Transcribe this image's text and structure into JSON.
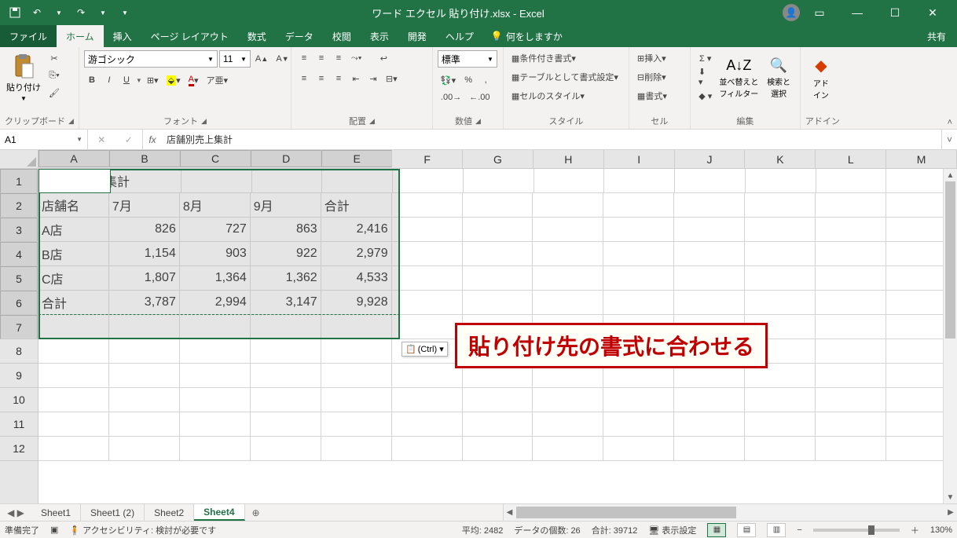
{
  "app": {
    "title": "ワード エクセル 貼り付け.xlsx - Excel"
  },
  "qat": {
    "save": "save-icon",
    "undo": "undo-icon",
    "redo": "redo-icon"
  },
  "tabs": {
    "file": "ファイル",
    "home": "ホーム",
    "insert": "挿入",
    "layout": "ページ レイアウト",
    "formulas": "数式",
    "data": "データ",
    "review": "校閲",
    "view": "表示",
    "dev": "開発",
    "help": "ヘルプ",
    "tellme": "何をしますか",
    "share": "共有"
  },
  "ribbon": {
    "clipboard": {
      "label": "クリップボード",
      "paste": "貼り付け"
    },
    "font": {
      "label": "フォント",
      "name": "游ゴシック",
      "size": "11",
      "bold": "B",
      "italic": "I",
      "underline": "U"
    },
    "align": {
      "label": "配置"
    },
    "number": {
      "label": "数値",
      "format": "標準"
    },
    "styles": {
      "label": "スタイル",
      "cond": "条件付き書式",
      "table": "テーブルとして書式設定",
      "cell": "セルのスタイル"
    },
    "cells": {
      "label": "セル",
      "insert": "挿入",
      "delete": "削除",
      "format": "書式"
    },
    "editing": {
      "label": "編集",
      "sort": "並べ替えと\nフィルター",
      "find": "検索と\n選択"
    },
    "addin": {
      "label": "アドイン",
      "btn": "アド\nイン"
    }
  },
  "formula_bar": {
    "cellref": "A1",
    "content": "店舗別売上集計"
  },
  "columns": [
    "A",
    "B",
    "C",
    "D",
    "E",
    "F",
    "G",
    "H",
    "I",
    "J",
    "K",
    "L",
    "M"
  ],
  "rows": [
    "1",
    "2",
    "3",
    "4",
    "5",
    "6",
    "7",
    "8",
    "9",
    "10",
    "11",
    "12"
  ],
  "data": {
    "r1": [
      "店舗別売上集計",
      "",
      "",
      "",
      "",
      "",
      "",
      "",
      "",
      "",
      "",
      "",
      ""
    ],
    "r2": [
      "店舗名",
      "7月",
      "8月",
      "9月",
      "合計",
      "",
      "",
      "",
      "",
      "",
      "",
      "",
      ""
    ],
    "r3": [
      "A店",
      "826",
      "727",
      "863",
      "2,416",
      "",
      "",
      "",
      "",
      "",
      "",
      "",
      ""
    ],
    "r4": [
      "B店",
      "1,154",
      "903",
      "922",
      "2,979",
      "",
      "",
      "",
      "",
      "",
      "",
      "",
      ""
    ],
    "r5": [
      "C店",
      "1,807",
      "1,364",
      "1,362",
      "4,533",
      "",
      "",
      "",
      "",
      "",
      "",
      "",
      ""
    ],
    "r6": [
      "合計",
      "3,787",
      "2,994",
      "3,147",
      "9,928",
      "",
      "",
      "",
      "",
      "",
      "",
      "",
      ""
    ]
  },
  "paste_options": "(Ctrl) ▾",
  "annotation": "貼り付け先の書式に合わせる",
  "sheets": {
    "s1": "Sheet1",
    "s2": "Sheet1 (2)",
    "s3": "Sheet2",
    "s4": "Sheet4"
  },
  "status": {
    "ready": "準備完了",
    "access": "アクセシビリティ: 検討が必要です",
    "avg": "平均: 2482",
    "count": "データの個数: 26",
    "sum": "合計: 39712",
    "display": "表示設定",
    "zoom": "130%"
  }
}
